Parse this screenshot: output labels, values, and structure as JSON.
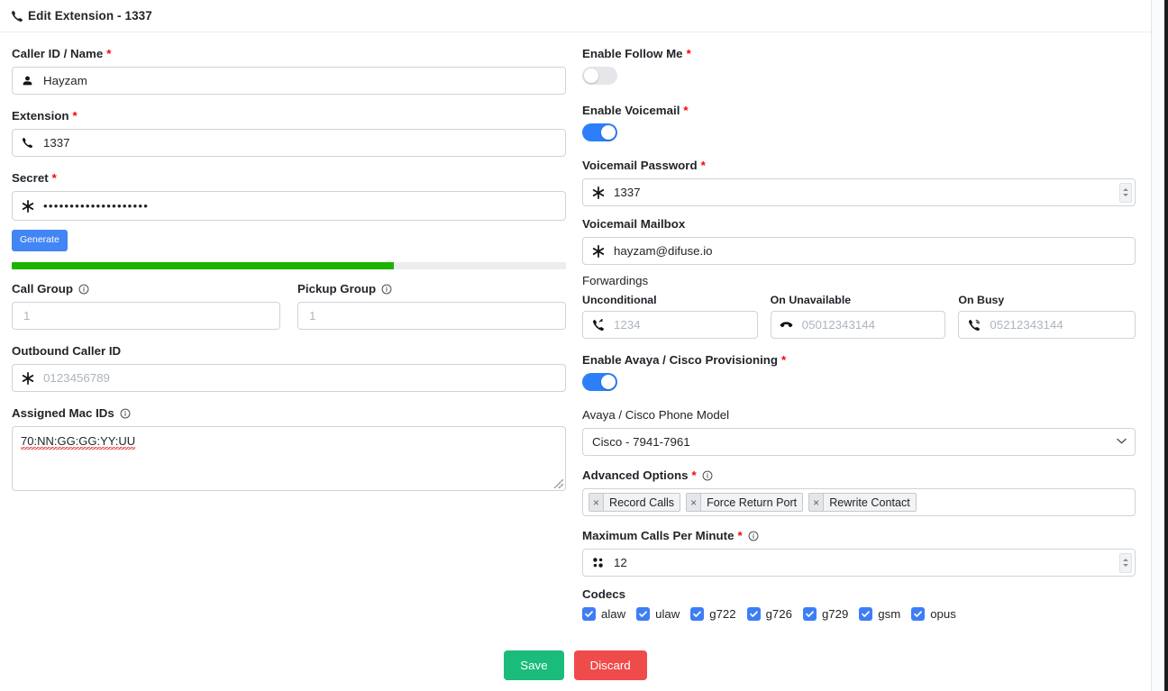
{
  "window": {
    "title": "Edit Extension - 1337",
    "title_icon": "phone-icon"
  },
  "left": {
    "caller_id": {
      "label": "Caller ID / Name",
      "required": "*",
      "icon": "person-icon",
      "value": "Hayzam"
    },
    "extension": {
      "label": "Extension",
      "required": "*",
      "icon": "phone-icon",
      "value": "1337"
    },
    "secret": {
      "label": "Secret",
      "required": "*",
      "icon": "asterisk-icon",
      "value": "••••••••••••••••••••",
      "generate_label": "Generate",
      "strength_percent": 69
    },
    "call_group": {
      "label": "Call Group",
      "info_icon": "info-icon",
      "placeholder": "1",
      "value": ""
    },
    "pickup_group": {
      "label": "Pickup Group",
      "info_icon": "info-icon",
      "placeholder": "1",
      "value": ""
    },
    "outbound_caller_id": {
      "label": "Outbound Caller ID",
      "icon": "asterisk-icon",
      "placeholder": "0123456789",
      "value": ""
    },
    "assigned_mac_ids": {
      "label": "Assigned Mac IDs",
      "info_icon": "info-icon",
      "value": "70:NN:GG:GG:YY:UU"
    }
  },
  "right": {
    "enable_follow_me": {
      "label": "Enable Follow Me",
      "required": "*",
      "state": "off"
    },
    "enable_voicemail": {
      "label": "Enable Voicemail",
      "required": "*",
      "state": "on"
    },
    "voicemail_password": {
      "label": "Voicemail Password",
      "required": "*",
      "icon": "asterisk-icon",
      "value": "1337"
    },
    "voicemail_mailbox": {
      "label": "Voicemail Mailbox",
      "icon": "asterisk-icon",
      "value": "hayzam@difuse.io"
    },
    "forwardings": {
      "label": "Forwardings",
      "items": [
        {
          "label": "Unconditional",
          "icon": "phone-forward-icon",
          "placeholder": "1234",
          "value": ""
        },
        {
          "label": "On Unavailable",
          "icon": "phone-hangup-icon",
          "placeholder": "05012343144",
          "value": ""
        },
        {
          "label": "On Busy",
          "icon": "phone-busy-icon",
          "placeholder": "05212343144",
          "value": ""
        }
      ]
    },
    "enable_provisioning": {
      "label": "Enable Avaya / Cisco Provisioning",
      "required": "*",
      "state": "on"
    },
    "phone_model": {
      "label": "Avaya / Cisco Phone Model",
      "selected": "Cisco - 7941-7961",
      "caret_icon": "chevron-down-icon"
    },
    "advanced_options": {
      "label": "Advanced Options",
      "required": "*",
      "info_icon": "info-icon",
      "tags": [
        "Record Calls",
        "Force Return Port",
        "Rewrite Contact"
      ],
      "remove_glyph": "×"
    },
    "max_calls_per_minute": {
      "label": "Maximum Calls Per Minute",
      "required": "*",
      "info_icon": "info-icon",
      "icon": "grid-dots-icon",
      "value": "12"
    },
    "codecs": {
      "label": "Codecs",
      "items": [
        {
          "name": "alaw",
          "checked": true
        },
        {
          "name": "ulaw",
          "checked": true
        },
        {
          "name": "g722",
          "checked": true
        },
        {
          "name": "g726",
          "checked": true
        },
        {
          "name": "g729",
          "checked": true
        },
        {
          "name": "gsm",
          "checked": true
        },
        {
          "name": "opus",
          "checked": true
        }
      ]
    }
  },
  "footer": {
    "save_label": "Save",
    "discard_label": "Discard"
  },
  "colors": {
    "accent_blue": "#2d7ff9",
    "save_green": "#1abc7b",
    "discard_red": "#f04b4b",
    "strength_green": "#1eb300",
    "required_red": "#ff0000"
  }
}
